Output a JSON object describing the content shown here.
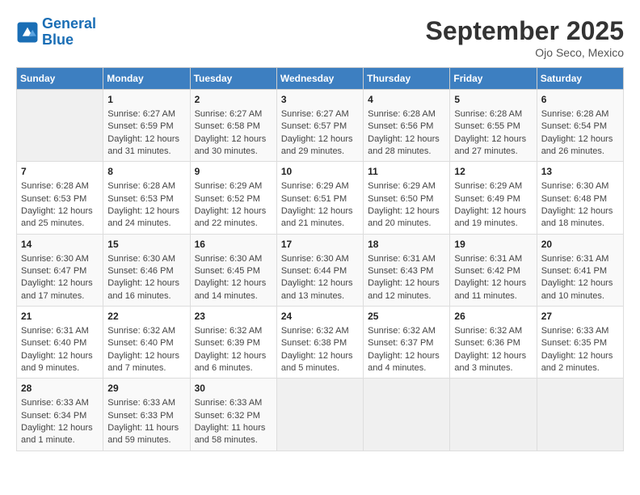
{
  "header": {
    "logo_line1": "General",
    "logo_line2": "Blue",
    "month_title": "September 2025",
    "location": "Ojo Seco, Mexico"
  },
  "days_of_week": [
    "Sunday",
    "Monday",
    "Tuesday",
    "Wednesday",
    "Thursday",
    "Friday",
    "Saturday"
  ],
  "weeks": [
    [
      {
        "day": "",
        "content": ""
      },
      {
        "day": "1",
        "content": "Sunrise: 6:27 AM\nSunset: 6:59 PM\nDaylight: 12 hours and 31 minutes."
      },
      {
        "day": "2",
        "content": "Sunrise: 6:27 AM\nSunset: 6:58 PM\nDaylight: 12 hours and 30 minutes."
      },
      {
        "day": "3",
        "content": "Sunrise: 6:27 AM\nSunset: 6:57 PM\nDaylight: 12 hours and 29 minutes."
      },
      {
        "day": "4",
        "content": "Sunrise: 6:28 AM\nSunset: 6:56 PM\nDaylight: 12 hours and 28 minutes."
      },
      {
        "day": "5",
        "content": "Sunrise: 6:28 AM\nSunset: 6:55 PM\nDaylight: 12 hours and 27 minutes."
      },
      {
        "day": "6",
        "content": "Sunrise: 6:28 AM\nSunset: 6:54 PM\nDaylight: 12 hours and 26 minutes."
      }
    ],
    [
      {
        "day": "7",
        "content": "Sunrise: 6:28 AM\nSunset: 6:53 PM\nDaylight: 12 hours and 25 minutes."
      },
      {
        "day": "8",
        "content": "Sunrise: 6:28 AM\nSunset: 6:53 PM\nDaylight: 12 hours and 24 minutes."
      },
      {
        "day": "9",
        "content": "Sunrise: 6:29 AM\nSunset: 6:52 PM\nDaylight: 12 hours and 22 minutes."
      },
      {
        "day": "10",
        "content": "Sunrise: 6:29 AM\nSunset: 6:51 PM\nDaylight: 12 hours and 21 minutes."
      },
      {
        "day": "11",
        "content": "Sunrise: 6:29 AM\nSunset: 6:50 PM\nDaylight: 12 hours and 20 minutes."
      },
      {
        "day": "12",
        "content": "Sunrise: 6:29 AM\nSunset: 6:49 PM\nDaylight: 12 hours and 19 minutes."
      },
      {
        "day": "13",
        "content": "Sunrise: 6:30 AM\nSunset: 6:48 PM\nDaylight: 12 hours and 18 minutes."
      }
    ],
    [
      {
        "day": "14",
        "content": "Sunrise: 6:30 AM\nSunset: 6:47 PM\nDaylight: 12 hours and 17 minutes."
      },
      {
        "day": "15",
        "content": "Sunrise: 6:30 AM\nSunset: 6:46 PM\nDaylight: 12 hours and 16 minutes."
      },
      {
        "day": "16",
        "content": "Sunrise: 6:30 AM\nSunset: 6:45 PM\nDaylight: 12 hours and 14 minutes."
      },
      {
        "day": "17",
        "content": "Sunrise: 6:30 AM\nSunset: 6:44 PM\nDaylight: 12 hours and 13 minutes."
      },
      {
        "day": "18",
        "content": "Sunrise: 6:31 AM\nSunset: 6:43 PM\nDaylight: 12 hours and 12 minutes."
      },
      {
        "day": "19",
        "content": "Sunrise: 6:31 AM\nSunset: 6:42 PM\nDaylight: 12 hours and 11 minutes."
      },
      {
        "day": "20",
        "content": "Sunrise: 6:31 AM\nSunset: 6:41 PM\nDaylight: 12 hours and 10 minutes."
      }
    ],
    [
      {
        "day": "21",
        "content": "Sunrise: 6:31 AM\nSunset: 6:40 PM\nDaylight: 12 hours and 9 minutes."
      },
      {
        "day": "22",
        "content": "Sunrise: 6:32 AM\nSunset: 6:40 PM\nDaylight: 12 hours and 7 minutes."
      },
      {
        "day": "23",
        "content": "Sunrise: 6:32 AM\nSunset: 6:39 PM\nDaylight: 12 hours and 6 minutes."
      },
      {
        "day": "24",
        "content": "Sunrise: 6:32 AM\nSunset: 6:38 PM\nDaylight: 12 hours and 5 minutes."
      },
      {
        "day": "25",
        "content": "Sunrise: 6:32 AM\nSunset: 6:37 PM\nDaylight: 12 hours and 4 minutes."
      },
      {
        "day": "26",
        "content": "Sunrise: 6:32 AM\nSunset: 6:36 PM\nDaylight: 12 hours and 3 minutes."
      },
      {
        "day": "27",
        "content": "Sunrise: 6:33 AM\nSunset: 6:35 PM\nDaylight: 12 hours and 2 minutes."
      }
    ],
    [
      {
        "day": "28",
        "content": "Sunrise: 6:33 AM\nSunset: 6:34 PM\nDaylight: 12 hours and 1 minute."
      },
      {
        "day": "29",
        "content": "Sunrise: 6:33 AM\nSunset: 6:33 PM\nDaylight: 11 hours and 59 minutes."
      },
      {
        "day": "30",
        "content": "Sunrise: 6:33 AM\nSunset: 6:32 PM\nDaylight: 11 hours and 58 minutes."
      },
      {
        "day": "",
        "content": ""
      },
      {
        "day": "",
        "content": ""
      },
      {
        "day": "",
        "content": ""
      },
      {
        "day": "",
        "content": ""
      }
    ]
  ]
}
